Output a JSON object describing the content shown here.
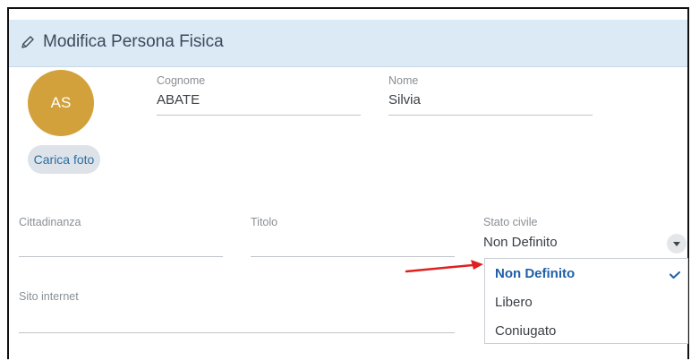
{
  "header": {
    "title": "Modifica Persona Fisica",
    "icon": "pencil-icon"
  },
  "avatar": {
    "initials": "AS",
    "color": "#d2a13b"
  },
  "photo_button": {
    "label": "Carica foto"
  },
  "fields": {
    "cognome": {
      "label": "Cognome",
      "value": "ABATE"
    },
    "nome": {
      "label": "Nome",
      "value": "Silvia"
    },
    "cittadinanza": {
      "label": "Cittadinanza",
      "value": ""
    },
    "titolo": {
      "label": "Titolo",
      "value": ""
    },
    "stato_civile": {
      "label": "Stato civile",
      "value": "Non Definito"
    },
    "sito_internet": {
      "label": "Sito internet",
      "value": ""
    }
  },
  "dropdown": {
    "options": [
      "Non Definito",
      "Libero",
      "Coniugato"
    ],
    "selected_index": 0
  },
  "colors": {
    "accent": "#1f5fa8",
    "header_bg": "#dceaf6",
    "arrow": "#e02020"
  }
}
